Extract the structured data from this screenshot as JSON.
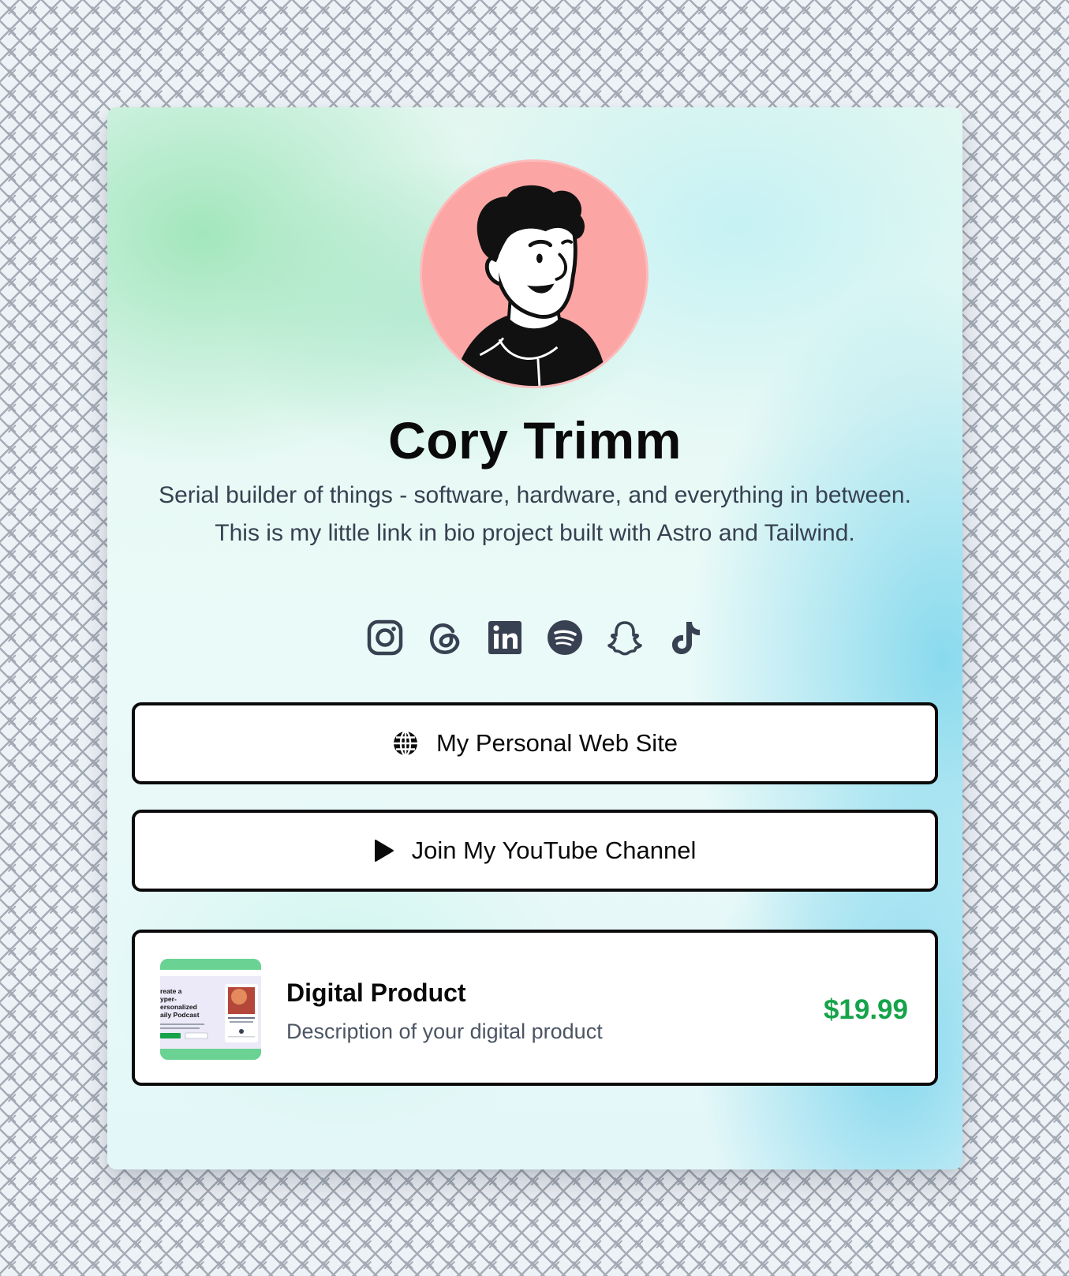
{
  "profile": {
    "name": "Cory Trimm",
    "bio": "Serial builder of things - software, hardware, and everything in between. This is my little link in bio project built with Astro and Tailwind.",
    "avatar_bg": "#fca5a5"
  },
  "socials": [
    {
      "name": "instagram",
      "icon": "instagram-icon"
    },
    {
      "name": "threads",
      "icon": "threads-icon"
    },
    {
      "name": "linkedin",
      "icon": "linkedin-icon"
    },
    {
      "name": "spotify",
      "icon": "spotify-icon"
    },
    {
      "name": "snapchat",
      "icon": "snapchat-icon"
    },
    {
      "name": "tiktok",
      "icon": "tiktok-icon"
    }
  ],
  "links": {
    "website": {
      "label": "My Personal Web Site",
      "icon": "globe-icon"
    },
    "youtube": {
      "label": "Join My YouTube Channel",
      "icon": "play-icon"
    }
  },
  "product": {
    "title": "Digital Product",
    "description": "Description of your digital product",
    "price": "$19.99",
    "price_color": "#16a34a",
    "thumb_text": {
      "line1": "reate a",
      "line2": "yper-",
      "line3": "ersonalized",
      "line4": "aily Podcast"
    }
  },
  "colors": {
    "page_bg": "#edf2f7",
    "button_border": "#0a0a0a",
    "text_dark": "#0a0a0a",
    "text_muted": "#374151"
  }
}
